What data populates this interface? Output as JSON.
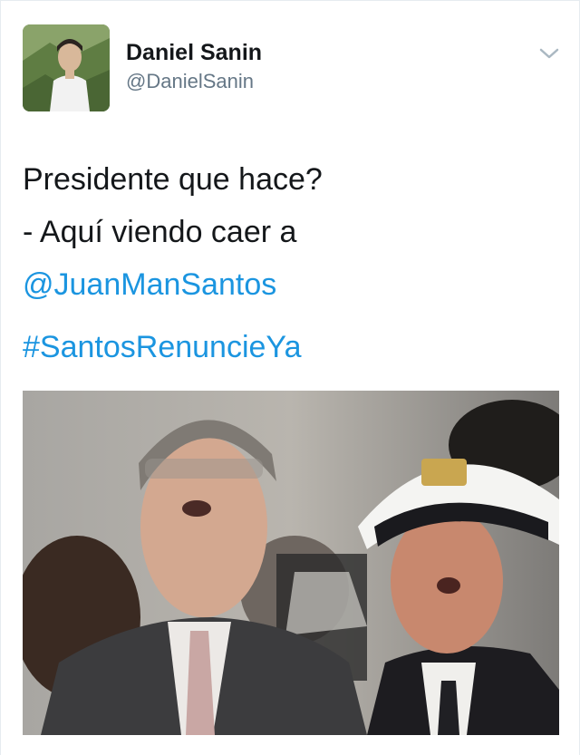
{
  "author": {
    "display_name": "Daniel Sanin",
    "handle": "@DanielSanin",
    "avatar_icon": "profile-photo"
  },
  "tweet": {
    "line1": "Presidente que hace?",
    "line2": "- Aquí viendo caer a",
    "mention": "@JuanManSantos",
    "hashtag": "#SantosRenuncieYa"
  },
  "icons": {
    "menu": "chevron-down-icon"
  },
  "colors": {
    "link": "#1b95e0",
    "secondary_text": "#657786",
    "primary_text": "#14171a"
  },
  "media": {
    "kind": "photo",
    "description_icon": "photo-two-men-looking-up"
  }
}
